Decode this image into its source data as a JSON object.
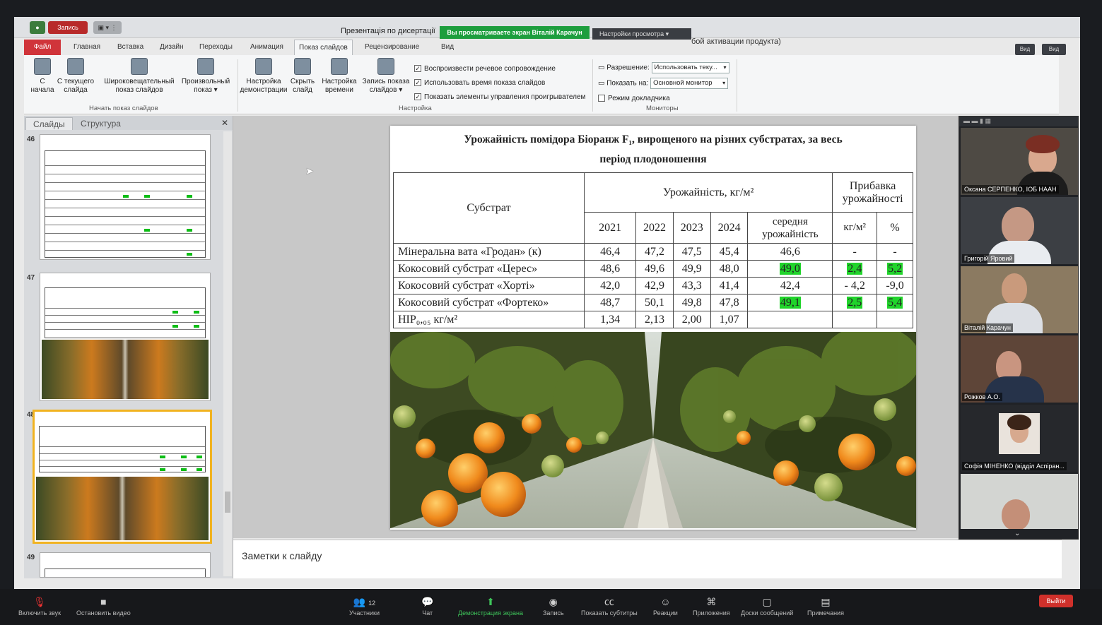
{
  "window": {
    "title": "Презентація по дисертації",
    "title_suffix": "бой активации продукта)",
    "record_label": "Запись",
    "btn_view1": "Вид",
    "btn_view2": "Вид"
  },
  "zoom_share": {
    "banner": "Вы просматриваете экран Віталій Карачун",
    "view_options": "Настройки просмотра"
  },
  "tabs": [
    "Файл",
    "Главная",
    "Вставка",
    "Дизайн",
    "Переходы",
    "Анимация",
    "Показ слайдов",
    "Рецензирование",
    "Вид"
  ],
  "ribbon": {
    "start_group": "Начать показ слайдов",
    "setup_group": "Настройка",
    "monitors_group": "Мониторы",
    "buttons": [
      {
        "l1": "С",
        "l2": "начала"
      },
      {
        "l1": "С текущего",
        "l2": "слайда"
      },
      {
        "l1": "Широковещательный",
        "l2": "показ слайдов"
      },
      {
        "l1": "Произвольный",
        "l2": "показ ▾"
      },
      {
        "l1": "Настройка",
        "l2": "демонстрации"
      },
      {
        "l1": "Скрыть",
        "l2": "слайд"
      },
      {
        "l1": "Настройка",
        "l2": "времени"
      },
      {
        "l1": "Запись показа",
        "l2": "слайдов ▾"
      }
    ],
    "checks": [
      {
        "label": "Воспроизвести речевое сопровождение",
        "mark": "✓"
      },
      {
        "label": "Использовать время показа слайдов",
        "mark": "✓"
      },
      {
        "label": "Показать элементы управления проигрывателем",
        "mark": "✓"
      }
    ],
    "resolution_label": "Разрешение:",
    "resolution_value": "Использовать теку...",
    "show_on_label": "Показать на:",
    "show_on_value": "Основной монитор",
    "presenter_label": "Режим докладчика"
  },
  "left_panel": {
    "tab_slides": "Слайды",
    "tab_outline": "Структура",
    "close": "✕",
    "slide_numbers": [
      "46",
      "47",
      "48",
      "49"
    ]
  },
  "slide": {
    "title_l1": "Урожайність помідора Біоранж F₁, вирощеного на різних субстратах, за весь",
    "title_l2": "період плодоношення",
    "h_substrate": "Субстрат",
    "h_yield": "Урожайність, кг/м²",
    "h_increase_l1": "Прибавка",
    "h_increase_l2": "урожайності",
    "years": [
      "2021",
      "2022",
      "2023",
      "2024"
    ],
    "h_avg_l1": "середня",
    "h_avg_l2": "урожайність",
    "h_kg": "кг/м²",
    "h_pct": "%",
    "rows": [
      {
        "name": "Мінеральна вата «Гродан» (к)",
        "v": [
          "46,4",
          "47,2",
          "47,5",
          "45,4"
        ],
        "avg": "46,6",
        "kg": "-",
        "pct": "-"
      },
      {
        "name": "Кокосовий субстрат «Церес»",
        "v": [
          "48,6",
          "49,6",
          "49,9",
          "48,0"
        ],
        "avg": "49,0",
        "kg": "2,4",
        "pct": "5,2"
      },
      {
        "name": "Кокосовий субстрат «Хорті»",
        "v": [
          "42,0",
          "42,9",
          "43,3",
          "41,4"
        ],
        "avg": "42,4",
        "kg": "- 4,2",
        "pct": "-9,0"
      },
      {
        "name": "Кокосовий субстрат «Фортеко»",
        "v": [
          "48,7",
          "50,1",
          "49,8",
          "47,8"
        ],
        "avg": "49,1",
        "kg": "2,5",
        "pct": "5,4"
      }
    ],
    "hip_label": "НІР₀,₀₅ кг/м²",
    "hip_values": [
      "1,34",
      "2,13",
      "2,00",
      "1,07"
    ],
    "highlight_color": "#21d42b"
  },
  "notes": {
    "placeholder": "Заметки к слайду"
  },
  "participants": [
    {
      "name": "Оксана СЕРПЕНКО, ІОБ НААН"
    },
    {
      "name": "Григорій Яровий"
    },
    {
      "name": "Віталій Карачун"
    },
    {
      "name": "Рожков А.О."
    },
    {
      "name": "Софія МІНЕНКО (відділ Аспіран..."
    },
    {
      "name": ""
    }
  ],
  "zoom_toolbar": {
    "mute": "Включить звук",
    "video": "Остановить видео",
    "participants": "Участники",
    "participants_count": "12",
    "chat": "Чат",
    "share": "Демонстрация экрана",
    "record": "Запись",
    "captions": "Показать субтитры",
    "reactions": "Реакции",
    "apps": "Приложения",
    "whiteboards": "Доски сообщений",
    "notes": "Примечания",
    "leave": "Выйти"
  }
}
